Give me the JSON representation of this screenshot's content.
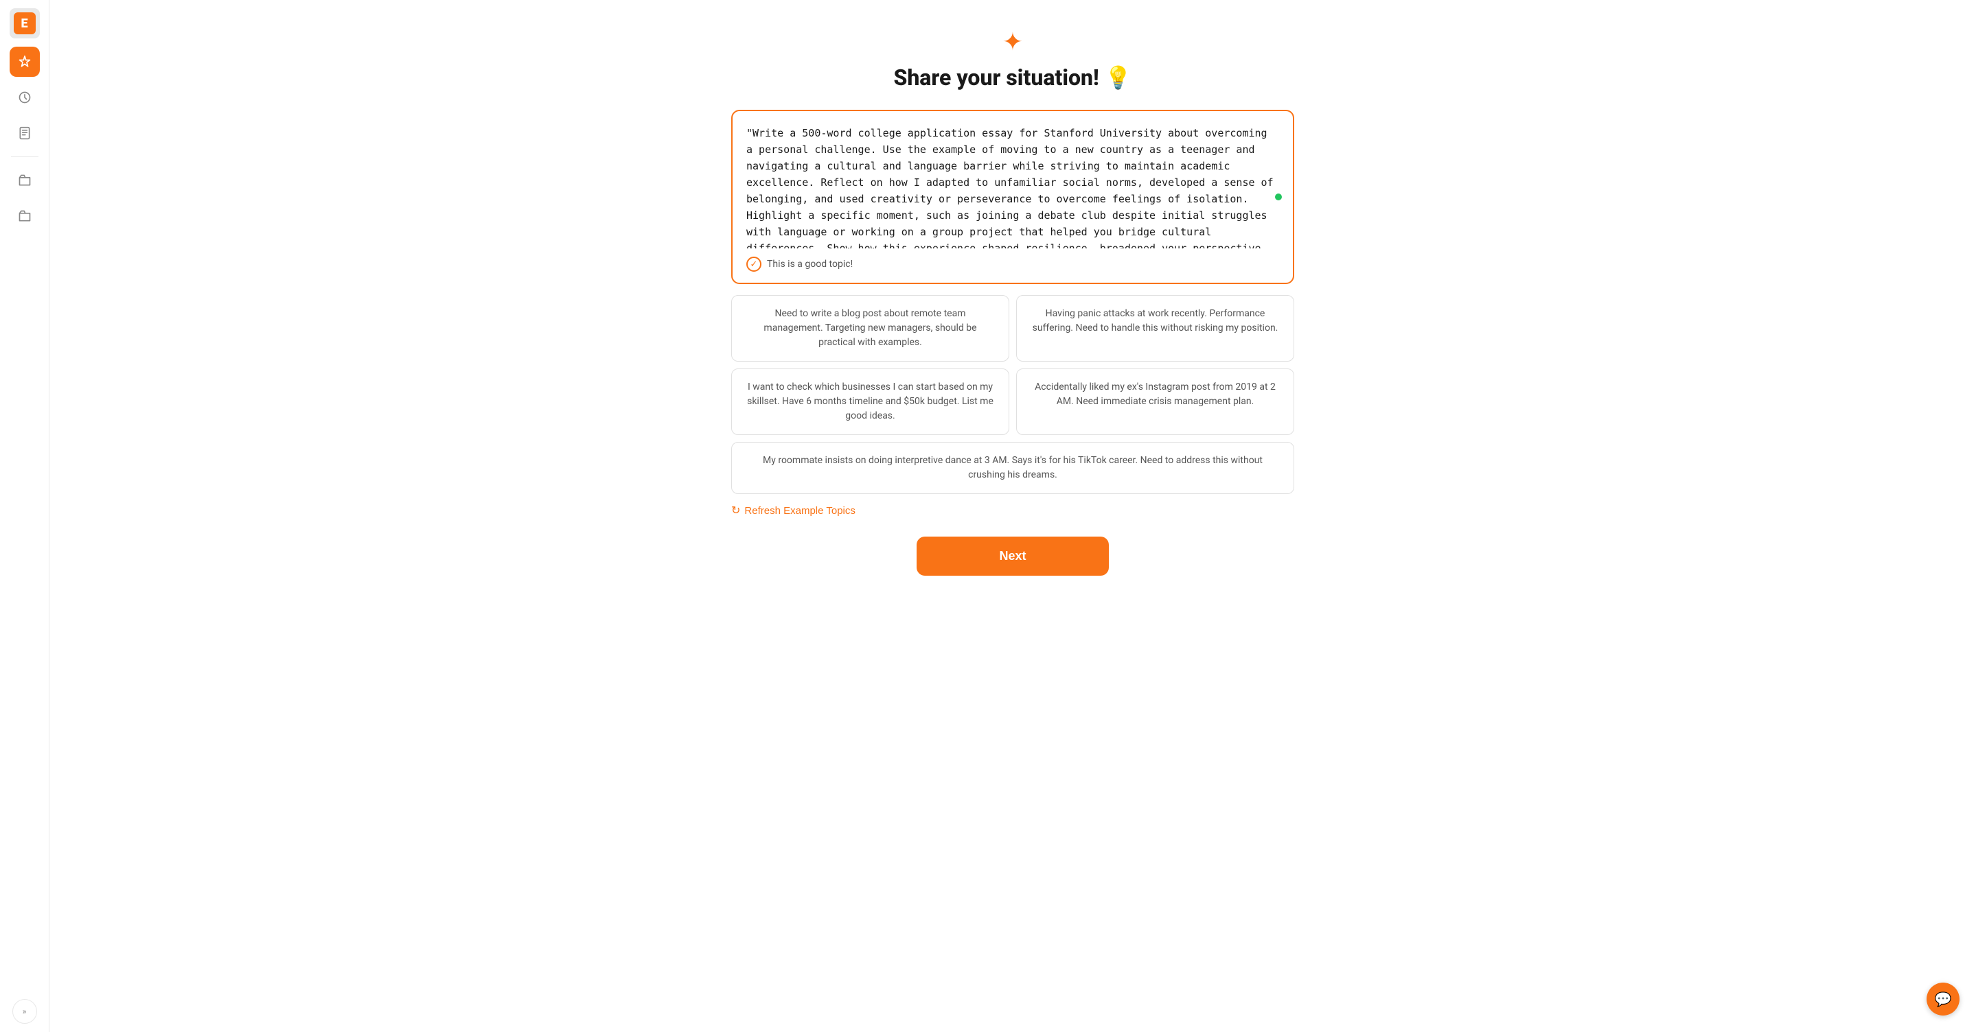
{
  "sidebar": {
    "logo_letter": "E",
    "expand_label": "»",
    "items": [
      {
        "name": "ai-assistant",
        "label": "AI Assistant",
        "active": true
      },
      {
        "name": "history",
        "label": "History",
        "active": false
      },
      {
        "name": "documents",
        "label": "Documents",
        "active": false
      },
      {
        "name": "folder1",
        "label": "Folder",
        "active": false
      },
      {
        "name": "folder2",
        "label": "Folder 2",
        "active": false
      }
    ]
  },
  "page": {
    "spark_icon": "✦",
    "title": "Share your situation!",
    "title_emoji": "💡",
    "input_text": "\"Write a 500-word college application essay for Stanford University about overcoming a personal challenge. Use the example of moving to a new country as a teenager and navigating a cultural and language barrier while striving to maintain academic excellence. Reflect on how I adapted to unfamiliar social norms, developed a sense of belonging, and used creativity or perseverance to overcome feelings of isolation. Highlight a specific moment, such as joining a debate club despite initial struggles with language or working on a group project that helped you bridge cultural differences. Show how this experience shaped resilience, broadened your perspective, and prepared you to embrace Stanford's diverse community and opportunities.\" write in German language",
    "good_topic_label": "This is a good topic!",
    "example_topics": [
      {
        "id": "topic-1",
        "text": "Need to write a blog post about remote team management. Targeting new managers, should be practical with examples.",
        "full_width": false
      },
      {
        "id": "topic-2",
        "text": "Having panic attacks at work recently. Performance suffering. Need to handle this without risking my position.",
        "full_width": false
      },
      {
        "id": "topic-3",
        "text": "I want to check which businesses I can start based on my skillset. Have 6 months timeline and $50k budget. List me good ideas.",
        "full_width": false
      },
      {
        "id": "topic-4",
        "text": "Accidentally liked my ex's Instagram post from 2019 at 2 AM. Need immediate crisis management plan.",
        "full_width": false
      },
      {
        "id": "topic-5",
        "text": "My roommate insists on doing interpretive dance at 3 AM. Says it's for his TikTok career. Need to address this without crushing his dreams.",
        "full_width": true
      }
    ],
    "refresh_label": "Refresh Example Topics",
    "next_label": "Next"
  },
  "bottom_avatar": {
    "icon": "💬"
  }
}
